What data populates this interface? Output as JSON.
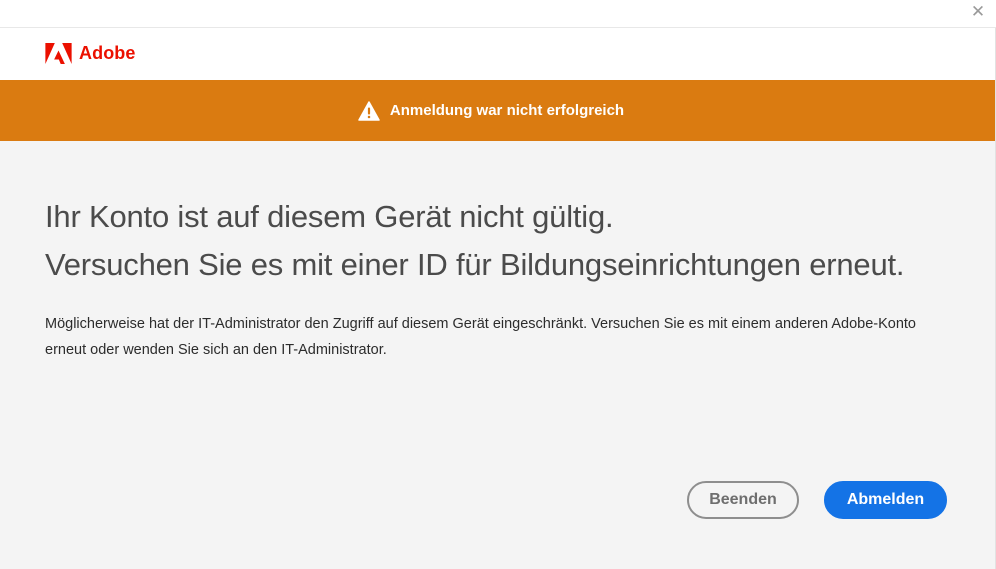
{
  "window": {
    "close_glyph": "✕"
  },
  "header": {
    "brand": "Adobe",
    "brand_color": "#eb1000"
  },
  "banner": {
    "icon": "warning-icon",
    "message": "Anmeldung war nicht erfolgreich",
    "color": "#da7b11"
  },
  "main": {
    "heading_line1": "Ihr Konto ist auf diesem Gerät nicht gültig.",
    "heading_line2": "Versuchen Sie es mit einer ID für Bildungseinrichtungen erneut.",
    "description": "Möglicherweise hat der IT-Administrator den Zugriff auf diesem Gerät eingeschränkt. Versuchen Sie es mit einem anderen Adobe-Konto erneut oder wenden Sie sich an den IT-Administrator."
  },
  "actions": {
    "quit_label": "Beenden",
    "logout_label": "Abmelden",
    "primary_color": "#1473e6"
  }
}
